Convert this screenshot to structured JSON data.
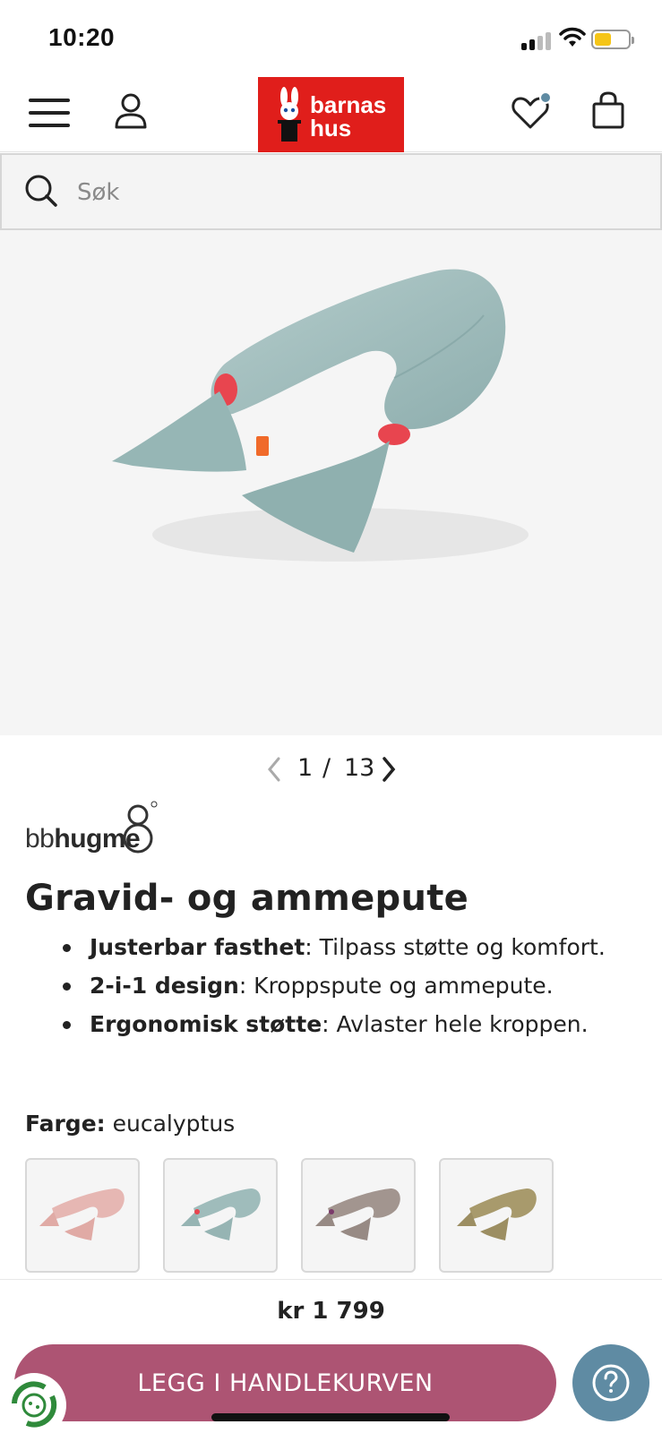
{
  "status_bar": {
    "time": "10:20",
    "battery_level": 0.4,
    "battery_color": "#f5c518"
  },
  "header": {
    "menu_icon": "hamburger-menu-icon",
    "account_icon": "user-icon",
    "logo": {
      "line1": "barnas",
      "line2": "hus",
      "background": "#e01e1b"
    },
    "wishlist_icon": "heart-icon",
    "cart_icon": "shopping-bag-icon"
  },
  "search": {
    "placeholder": "Søk",
    "icon": "search-icon"
  },
  "gallery": {
    "current": "1",
    "separator": "/",
    "total": "13",
    "prev_icon": "chevron-left-icon",
    "next_icon": "chevron-right-icon"
  },
  "product": {
    "brand_light": "bb",
    "brand_bold": "hugme",
    "title": "Gravid- og ammepute",
    "features": [
      {
        "label": "Justerbar fasthet",
        "text": ": Tilpass støtte og komfort."
      },
      {
        "label": "2-i-1 design",
        "text": ": Kroppspute og ammepute."
      },
      {
        "label": "Ergonomisk støtte",
        "text": ": Avlaster hele kroppen."
      }
    ],
    "color_label": "Farge:",
    "color_value": "eucalyptus",
    "swatches": [
      {
        "color": "#e6b7b3"
      },
      {
        "color": "#9fbcbb"
      },
      {
        "color": "#a2958f"
      },
      {
        "color": "#a89a6c"
      }
    ]
  },
  "purchase": {
    "price": "kr 1 799",
    "button_label": "LEGG I HANDLEKURVEN",
    "button_color": "#ad5473",
    "help_icon": "question-mark-icon",
    "help_color": "#5f8ba3"
  }
}
